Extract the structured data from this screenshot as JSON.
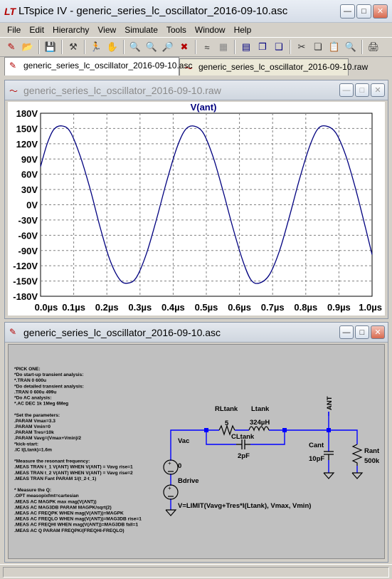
{
  "app": {
    "title": "LTspice IV - generic_series_lc_oscillator_2016-09-10.asc"
  },
  "menu": [
    "File",
    "Edit",
    "Hierarchy",
    "View",
    "Simulate",
    "Tools",
    "Window",
    "Help"
  ],
  "toolbar_icons": [
    "new-schematic-icon",
    "open-icon",
    "save-icon",
    "control-panel-icon",
    "run-icon",
    "pan-icon",
    "zoom-in-icon",
    "zoom-back-icon",
    "zoom-out-icon",
    "zoom-fit-icon",
    "autorange-icon",
    "grid-icon",
    "tile-icon",
    "cascade-icon",
    "close-all-icon",
    "cut-icon",
    "copy-icon",
    "paste-icon",
    "find-icon",
    "print-icon"
  ],
  "tabs": {
    "schematic": "generic_series_lc_oscillator_2016-09-10.asc",
    "waveform": "generic_series_lc_oscillator_2016-09-10.raw"
  },
  "waveform_window": {
    "title": "generic_series_lc_oscillator_2016-09-10.raw"
  },
  "schematic_window": {
    "title": "generic_series_lc_oscillator_2016-09-10.asc"
  },
  "chart_data": {
    "type": "line",
    "title": "V(ant)",
    "xlabel": "",
    "ylabel": "",
    "xlim": [
      0,
      1.0
    ],
    "ylim": [
      -180,
      180
    ],
    "x_ticks": [
      "0.0µs",
      "0.1µs",
      "0.2µs",
      "0.3µs",
      "0.4µs",
      "0.5µs",
      "0.6µs",
      "0.7µs",
      "0.8µs",
      "0.9µs",
      "1.0µs"
    ],
    "y_ticks": [
      "180V",
      "150V",
      "120V",
      "90V",
      "60V",
      "30V",
      "0V",
      "-30V",
      "-60V",
      "-90V",
      "-120V",
      "-150V",
      "-180V"
    ],
    "grid": true,
    "series": [
      {
        "name": "V(ant)",
        "color": "#00007f",
        "x": [
          0.0,
          0.02,
          0.04,
          0.065,
          0.09,
          0.12,
          0.15,
          0.18,
          0.21,
          0.24,
          0.265,
          0.29,
          0.32,
          0.35,
          0.38,
          0.41,
          0.435,
          0.46,
          0.49,
          0.52,
          0.55,
          0.58,
          0.61,
          0.635,
          0.66,
          0.69,
          0.72,
          0.75,
          0.78,
          0.81,
          0.835,
          0.86,
          0.89,
          0.92,
          0.95,
          0.98,
          1.0
        ],
        "y": [
          75,
          120,
          148,
          155,
          143,
          95,
          30,
          -45,
          -110,
          -148,
          -154,
          -142,
          -95,
          -28,
          45,
          110,
          146,
          155,
          142,
          95,
          28,
          -45,
          -110,
          -148,
          -154,
          -138,
          -92,
          -25,
          48,
          112,
          148,
          155,
          142,
          98,
          32,
          -45,
          -98
        ]
      }
    ]
  },
  "schematic": {
    "directives": [
      "*PICK ONE:",
      "*Do start-up transient analysis:",
      "*.TRAN 0 600u",
      "*Do detailed transient analysis:",
      ".TRAN 0 600u 499u",
      "*Do AC analysis:",
      "*.AC DEC 1k 1Meg 6Meg",
      "",
      "*Set the parameters:",
      ".PARAM Vmax=3.3",
      ".PARAM Vmin=0",
      ".PARAM Tres=10k",
      ".PARAM Vavg=(Vmax+Vmin)/2",
      "*kick-start:",
      ".IC I(Ltank)=1.6m",
      "",
      "*Measure the resonant frequency:",
      ".MEAS TRAN t_1 V(ANT) WHEN V(ANT) = Vavg rise=1",
      ".MEAS TRAN t_2 V(ANT) WHEN V(ANT) = Vavg rise=2",
      ".MEAS TRAN Fant PARAM 1/(t_2-t_1)",
      "",
      "* Measure the Q:",
      ".OPT measopixfmt=cartesian",
      ".MEAS AC MAGPK max mag(V(ANT))",
      ".MEAS AC MAG3DB PARAM MAGPK/sqrt(2)",
      ".MEAS AC FREQPK WHEN mag(V(ANT))=MAGPK",
      ".MEAS AC FREQLO WHEN mag(V(ANT))=MAG3DB rise=1",
      ".MEAS AC FREQHI WHEN mag(V(ANT))=MAG3DB fall=1",
      ".MEAS AC Q PARAM FREQPK/(FREQHI-FREQLO)"
    ],
    "labels": {
      "rltank_name": "RLtank",
      "rltank_value": "5",
      "ltank_name": "Ltank",
      "ltank_value": "324µH",
      "cltank_name": "CLtank",
      "cltank_value": "2pF",
      "vac_name": "Vac",
      "vac_value": "0",
      "bdrive_name": "Bdrive",
      "bdrive_expr": "V=LIMIT(Vavg+Tres*I(Ltank), Vmax, Vmin)",
      "cant_name": "Cant",
      "cant_value": "10pF",
      "rant_name": "Rant",
      "rant_value": "500k",
      "net_ant": "ANT"
    }
  }
}
